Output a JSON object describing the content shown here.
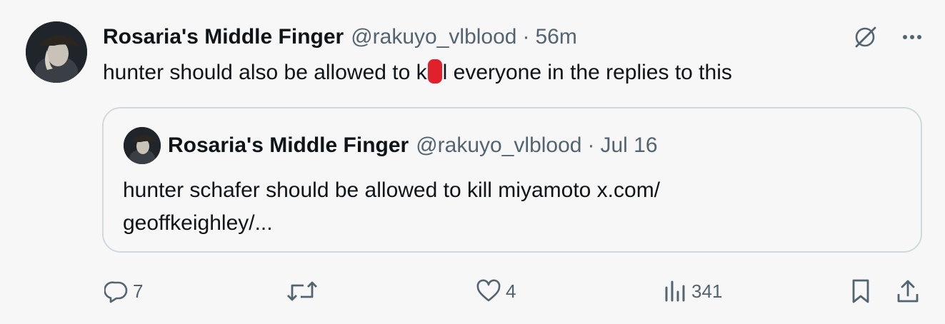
{
  "tweet": {
    "author_name": "Rosaria's Middle Finger",
    "handle": "@rakuyo_vlblood",
    "separator": "·",
    "time": "56m",
    "text_before": "hunter should also be allowed to k",
    "text_after": "l everyone in the replies to this"
  },
  "quote": {
    "author_name": "Rosaria's Middle Finger",
    "handle": "@rakuyo_vlblood",
    "separator": "·",
    "date": "Jul 16",
    "text": "hunter schafer should be allowed to kill miyamoto x.com/ geoffkeighley/..."
  },
  "actions": {
    "replies": "7",
    "retweets": "",
    "likes": "4",
    "views": "341"
  },
  "icons": [
    "grok-icon",
    "more-icon",
    "reply-icon",
    "retweet-icon",
    "like-icon",
    "views-icon",
    "bookmark-icon",
    "share-icon"
  ],
  "colors": {
    "text": "#0f1419",
    "secondary": "#536471",
    "border": "#cfd9de",
    "redaction": "#e0202a",
    "background": "#f7f7f7"
  }
}
